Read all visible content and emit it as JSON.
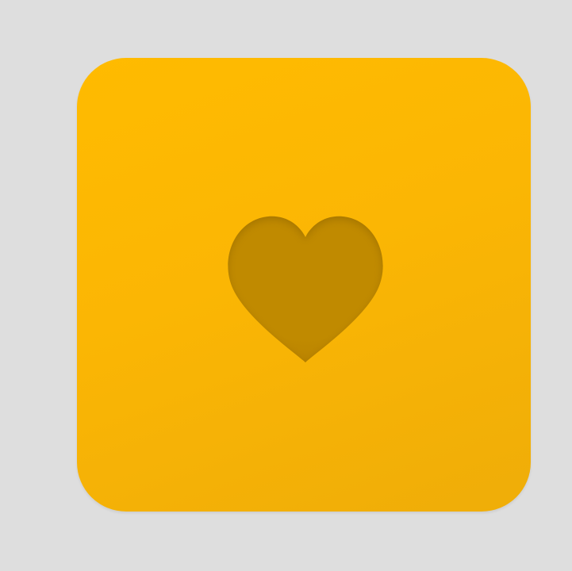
{
  "tile": {
    "color": "#fbb604",
    "icon": "heart-icon"
  },
  "heart": {
    "color": "#c08a00",
    "icon": "heart-icon"
  }
}
